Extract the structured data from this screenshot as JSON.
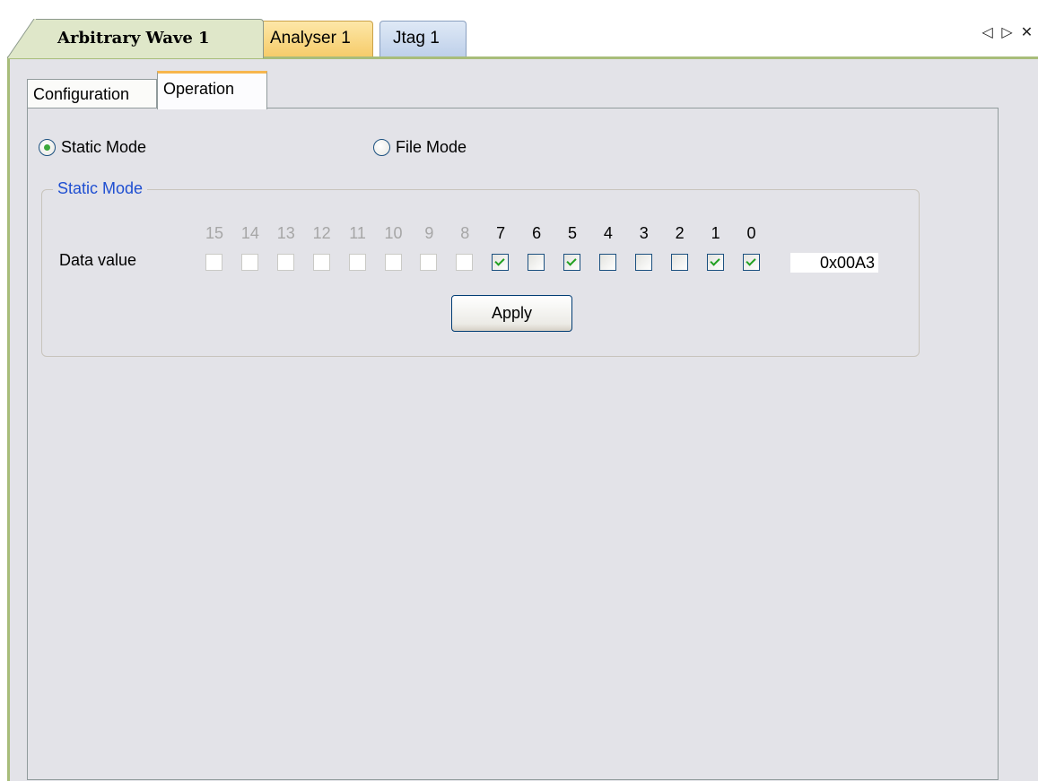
{
  "doc_tabs": [
    {
      "label": "Arbitrary Wave 1",
      "active": true
    },
    {
      "label": "Analyser 1",
      "active": false
    },
    {
      "label": "Jtag 1",
      "active": false
    }
  ],
  "nav": {
    "prev": "◁",
    "next": "▷",
    "close": "✕"
  },
  "inner_tabs": [
    {
      "label": "Configuration",
      "active": false
    },
    {
      "label": "Operation",
      "active": true
    }
  ],
  "modes": {
    "static_label": "Static Mode",
    "file_label": "File Mode",
    "selected": "Static Mode"
  },
  "static_group": {
    "legend": "Static Mode",
    "data_label": "Data value",
    "bits": [
      {
        "label": "15",
        "enabled": false,
        "checked": false
      },
      {
        "label": "14",
        "enabled": false,
        "checked": false
      },
      {
        "label": "13",
        "enabled": false,
        "checked": false
      },
      {
        "label": "12",
        "enabled": false,
        "checked": false
      },
      {
        "label": "11",
        "enabled": false,
        "checked": false
      },
      {
        "label": "10",
        "enabled": false,
        "checked": false
      },
      {
        "label": "9",
        "enabled": false,
        "checked": false
      },
      {
        "label": "8",
        "enabled": false,
        "checked": false
      },
      {
        "label": "7",
        "enabled": true,
        "checked": true
      },
      {
        "label": "6",
        "enabled": true,
        "checked": false
      },
      {
        "label": "5",
        "enabled": true,
        "checked": true
      },
      {
        "label": "4",
        "enabled": true,
        "checked": false
      },
      {
        "label": "3",
        "enabled": true,
        "checked": false
      },
      {
        "label": "2",
        "enabled": true,
        "checked": false
      },
      {
        "label": "1",
        "enabled": true,
        "checked": true
      },
      {
        "label": "0",
        "enabled": true,
        "checked": true
      }
    ],
    "hex_value": "0x00A3",
    "apply_label": "Apply"
  },
  "colors": {
    "active_tab": "#dfe7c9",
    "analyser_tab": "#f6cc6a",
    "jtag_tab": "#bed0ea",
    "legend_text": "#1f4fd1",
    "check_green": "#21a121"
  }
}
